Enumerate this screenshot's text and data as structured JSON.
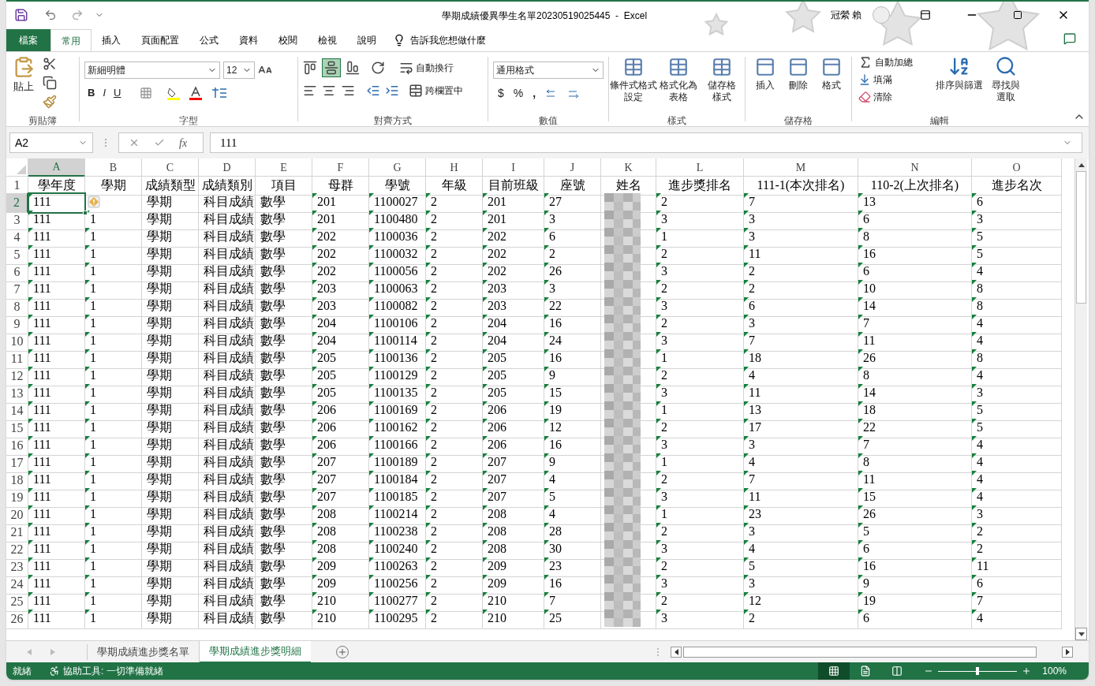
{
  "window": {
    "title": "學期成績優異學生名單20230519025445  -  Excel",
    "user": "冠縈 賴"
  },
  "tabs": [
    {
      "label": "檔案",
      "kind": "file",
      "selected": false
    },
    {
      "label": "常用",
      "kind": "tab",
      "selected": true
    },
    {
      "label": "插入",
      "kind": "tab",
      "selected": false
    },
    {
      "label": "頁面配置",
      "kind": "tab",
      "selected": false
    },
    {
      "label": "公式",
      "kind": "tab",
      "selected": false
    },
    {
      "label": "資料",
      "kind": "tab",
      "selected": false
    },
    {
      "label": "校閱",
      "kind": "tab",
      "selected": false
    },
    {
      "label": "檢視",
      "kind": "tab",
      "selected": false
    },
    {
      "label": "說明",
      "kind": "tab",
      "selected": false
    }
  ],
  "tell_me": "告訴我您想做什麼",
  "ribbon": {
    "clipboard": {
      "label": "剪貼簿",
      "paste": "貼上"
    },
    "font": {
      "label": "字型",
      "font_name": "新細明體",
      "font_size": "12",
      "bold": "B",
      "italic": "I",
      "underline": "U"
    },
    "alignment": {
      "label": "對齊方式",
      "wrap": "自動換行",
      "merge": "跨欄置中",
      "middle_selected": true
    },
    "number": {
      "label": "數值",
      "format": "通用格式",
      "currency": "$",
      "percent": "%",
      "comma": ","
    },
    "styles": {
      "label": "樣式",
      "buttons": [
        [
          "條件式格式",
          "設定"
        ],
        [
          "格式化為",
          "表格"
        ],
        [
          "儲存格",
          "樣式"
        ]
      ]
    },
    "cells": {
      "label": "儲存格",
      "buttons": [
        [
          "插入"
        ],
        [
          "刪除"
        ],
        [
          "格式"
        ]
      ]
    },
    "editing": {
      "label": "編輯",
      "autosum": "自動加總",
      "fill": "填滿",
      "clear": "清除",
      "sort": [
        "排序與篩選"
      ],
      "find": [
        "尋找與",
        "選取"
      ]
    }
  },
  "formula_bar": {
    "name_box": "A2",
    "function_symbol": "fx",
    "value": "111"
  },
  "columns": [
    {
      "letter": "A",
      "title": "學年度",
      "kind": "text",
      "marker": true,
      "selected": true
    },
    {
      "letter": "B",
      "title": "學期",
      "kind": "text",
      "marker": true,
      "selected": false
    },
    {
      "letter": "C",
      "title": "成績類型",
      "kind": "text",
      "marker": false,
      "selected": false
    },
    {
      "letter": "D",
      "title": "成績類別",
      "kind": "text",
      "marker": false,
      "selected": false
    },
    {
      "letter": "E",
      "title": "項目",
      "kind": "text",
      "marker": false,
      "selected": false
    },
    {
      "letter": "F",
      "title": "母群",
      "kind": "text",
      "marker": true,
      "selected": false
    },
    {
      "letter": "G",
      "title": "學號",
      "kind": "text",
      "marker": true,
      "selected": false
    },
    {
      "letter": "H",
      "title": "年級",
      "kind": "text",
      "marker": true,
      "selected": false
    },
    {
      "letter": "I",
      "title": "目前班級",
      "kind": "text",
      "marker": true,
      "selected": false
    },
    {
      "letter": "J",
      "title": "座號",
      "kind": "text",
      "marker": true,
      "selected": false
    },
    {
      "letter": "K",
      "title": "姓名",
      "kind": "blurred",
      "marker": false,
      "selected": false
    },
    {
      "letter": "L",
      "title": "進步獎排名",
      "kind": "text",
      "marker": true,
      "selected": false
    },
    {
      "letter": "M",
      "title": "111-1(本次排名)",
      "kind": "text",
      "marker": true,
      "selected": false
    },
    {
      "letter": "N",
      "title": "110-2(上次排名)",
      "kind": "text",
      "marker": true,
      "selected": false
    },
    {
      "letter": "O",
      "title": "進步名次",
      "kind": "text",
      "marker": true,
      "selected": false
    }
  ],
  "rows": [
    {
      "number": "2",
      "selected": true,
      "warning": true,
      "cells": [
        "111",
        null,
        "學期",
        "科目成績",
        "數學",
        "201",
        "1100027",
        "2",
        "201",
        "27",
        null,
        "2",
        "7",
        "13",
        "6"
      ]
    },
    {
      "number": "3",
      "selected": false,
      "warning": false,
      "cells": [
        "111",
        "1",
        "學期",
        "科目成績",
        "數學",
        "201",
        "1100480",
        "2",
        "201",
        "3",
        null,
        "3",
        "3",
        "6",
        "3"
      ]
    },
    {
      "number": "4",
      "selected": false,
      "warning": false,
      "cells": [
        "111",
        "1",
        "學期",
        "科目成績",
        "數學",
        "202",
        "1100036",
        "2",
        "202",
        "6",
        null,
        "1",
        "3",
        "8",
        "5"
      ]
    },
    {
      "number": "5",
      "selected": false,
      "warning": false,
      "cells": [
        "111",
        "1",
        "學期",
        "科目成績",
        "數學",
        "202",
        "1100032",
        "2",
        "202",
        "2",
        null,
        "2",
        "11",
        "16",
        "5"
      ]
    },
    {
      "number": "6",
      "selected": false,
      "warning": false,
      "cells": [
        "111",
        "1",
        "學期",
        "科目成績",
        "數學",
        "202",
        "1100056",
        "2",
        "202",
        "26",
        null,
        "3",
        "2",
        "6",
        "4"
      ]
    },
    {
      "number": "7",
      "selected": false,
      "warning": false,
      "cells": [
        "111",
        "1",
        "學期",
        "科目成績",
        "數學",
        "203",
        "1100063",
        "2",
        "203",
        "3",
        null,
        "2",
        "2",
        "10",
        "8"
      ]
    },
    {
      "number": "8",
      "selected": false,
      "warning": false,
      "cells": [
        "111",
        "1",
        "學期",
        "科目成績",
        "數學",
        "203",
        "1100082",
        "2",
        "203",
        "22",
        null,
        "3",
        "6",
        "14",
        "8"
      ]
    },
    {
      "number": "9",
      "selected": false,
      "warning": false,
      "cells": [
        "111",
        "1",
        "學期",
        "科目成績",
        "數學",
        "204",
        "1100106",
        "2",
        "204",
        "16",
        null,
        "2",
        "3",
        "7",
        "4"
      ]
    },
    {
      "number": "10",
      "selected": false,
      "warning": false,
      "cells": [
        "111",
        "1",
        "學期",
        "科目成績",
        "數學",
        "204",
        "1100114",
        "2",
        "204",
        "24",
        null,
        "3",
        "7",
        "11",
        "4"
      ]
    },
    {
      "number": "11",
      "selected": false,
      "warning": false,
      "cells": [
        "111",
        "1",
        "學期",
        "科目成績",
        "數學",
        "205",
        "1100136",
        "2",
        "205",
        "16",
        null,
        "1",
        "18",
        "26",
        "8"
      ]
    },
    {
      "number": "12",
      "selected": false,
      "warning": false,
      "cells": [
        "111",
        "1",
        "學期",
        "科目成績",
        "數學",
        "205",
        "1100129",
        "2",
        "205",
        "9",
        null,
        "2",
        "4",
        "8",
        "4"
      ]
    },
    {
      "number": "13",
      "selected": false,
      "warning": false,
      "cells": [
        "111",
        "1",
        "學期",
        "科目成績",
        "數學",
        "205",
        "1100135",
        "2",
        "205",
        "15",
        null,
        "3",
        "11",
        "14",
        "3"
      ]
    },
    {
      "number": "14",
      "selected": false,
      "warning": false,
      "cells": [
        "111",
        "1",
        "學期",
        "科目成績",
        "數學",
        "206",
        "1100169",
        "2",
        "206",
        "19",
        null,
        "1",
        "13",
        "18",
        "5"
      ]
    },
    {
      "number": "15",
      "selected": false,
      "warning": false,
      "cells": [
        "111",
        "1",
        "學期",
        "科目成績",
        "數學",
        "206",
        "1100162",
        "2",
        "206",
        "12",
        null,
        "2",
        "17",
        "22",
        "5"
      ]
    },
    {
      "number": "16",
      "selected": false,
      "warning": false,
      "cells": [
        "111",
        "1",
        "學期",
        "科目成績",
        "數學",
        "206",
        "1100166",
        "2",
        "206",
        "16",
        null,
        "3",
        "3",
        "7",
        "4"
      ]
    },
    {
      "number": "17",
      "selected": false,
      "warning": false,
      "cells": [
        "111",
        "1",
        "學期",
        "科目成績",
        "數學",
        "207",
        "1100189",
        "2",
        "207",
        "9",
        null,
        "1",
        "4",
        "8",
        "4"
      ]
    },
    {
      "number": "18",
      "selected": false,
      "warning": false,
      "cells": [
        "111",
        "1",
        "學期",
        "科目成績",
        "數學",
        "207",
        "1100184",
        "2",
        "207",
        "4",
        null,
        "2",
        "7",
        "11",
        "4"
      ]
    },
    {
      "number": "19",
      "selected": false,
      "warning": false,
      "cells": [
        "111",
        "1",
        "學期",
        "科目成績",
        "數學",
        "207",
        "1100185",
        "2",
        "207",
        "5",
        null,
        "3",
        "11",
        "15",
        "4"
      ]
    },
    {
      "number": "20",
      "selected": false,
      "warning": false,
      "cells": [
        "111",
        "1",
        "學期",
        "科目成績",
        "數學",
        "208",
        "1100214",
        "2",
        "208",
        "4",
        null,
        "1",
        "23",
        "26",
        "3"
      ]
    },
    {
      "number": "21",
      "selected": false,
      "warning": false,
      "cells": [
        "111",
        "1",
        "學期",
        "科目成績",
        "數學",
        "208",
        "1100238",
        "2",
        "208",
        "28",
        null,
        "2",
        "3",
        "5",
        "2"
      ]
    },
    {
      "number": "22",
      "selected": false,
      "warning": false,
      "cells": [
        "111",
        "1",
        "學期",
        "科目成績",
        "數學",
        "208",
        "1100240",
        "2",
        "208",
        "30",
        null,
        "3",
        "4",
        "6",
        "2"
      ]
    },
    {
      "number": "23",
      "selected": false,
      "warning": false,
      "cells": [
        "111",
        "1",
        "學期",
        "科目成績",
        "數學",
        "209",
        "1100263",
        "2",
        "209",
        "23",
        null,
        "2",
        "5",
        "16",
        "11"
      ]
    },
    {
      "number": "24",
      "selected": false,
      "warning": false,
      "cells": [
        "111",
        "1",
        "學期",
        "科目成績",
        "數學",
        "209",
        "1100256",
        "2",
        "209",
        "16",
        null,
        "3",
        "3",
        "9",
        "6"
      ]
    },
    {
      "number": "25",
      "selected": false,
      "warning": false,
      "cells": [
        "111",
        "1",
        "學期",
        "科目成績",
        "數學",
        "210",
        "1100277",
        "2",
        "210",
        "7",
        null,
        "2",
        "12",
        "19",
        "7"
      ]
    },
    {
      "number": "26",
      "selected": false,
      "warning": false,
      "cells": [
        "111",
        "1",
        "學期",
        "科目成績",
        "數學",
        "210",
        "1100295",
        "2",
        "210",
        "25",
        null,
        "3",
        "2",
        "6",
        "4"
      ]
    }
  ],
  "header_row_number": "1",
  "sheets": [
    {
      "label": "學期成績進步獎名單",
      "selected": false
    },
    {
      "label": "學期成績進步獎明細",
      "selected": true
    }
  ],
  "status_bar": {
    "ready": "就緒",
    "accessibility": "協助工具: 一切準備就緒",
    "views": [
      {
        "kind": "normal",
        "selected": true
      },
      {
        "kind": "page_layout",
        "selected": false
      },
      {
        "kind": "page_break",
        "selected": false
      }
    ],
    "zoom": {
      "level": 0.5,
      "reading": "100%"
    }
  }
}
